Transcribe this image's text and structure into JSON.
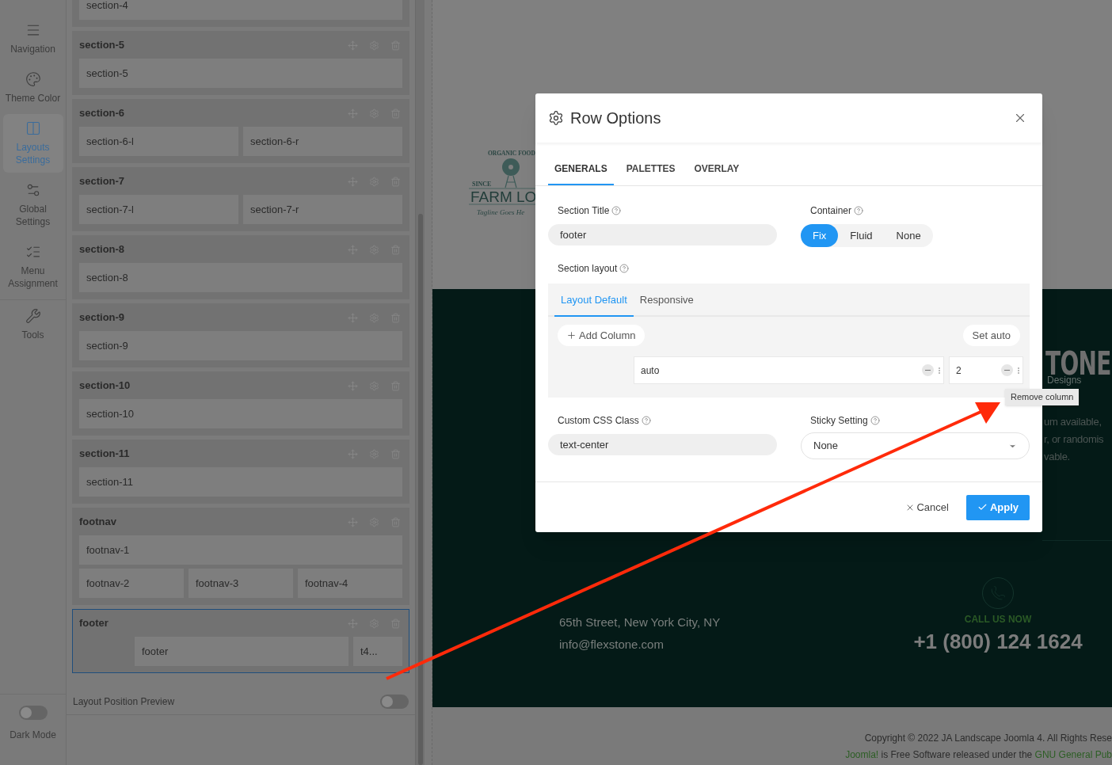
{
  "nav": {
    "items": [
      {
        "label": "Navigation",
        "selected": false
      },
      {
        "label": "Theme Color",
        "selected": false
      },
      {
        "label": "Layouts Settings",
        "selected": true
      },
      {
        "label": "Global Settings",
        "selected": false
      },
      {
        "label": "Menu Assignment",
        "selected": false
      },
      {
        "label": "Tools",
        "selected": false
      }
    ],
    "dark_mode": {
      "label": "Dark Mode",
      "on": false
    }
  },
  "layout": {
    "sections": [
      {
        "selected": false,
        "offset": false,
        "rows": [
          [
            "section-4"
          ]
        ]
      },
      {
        "title": "section-5",
        "selected": false,
        "offset": false,
        "rows": [
          [
            "section-5"
          ]
        ]
      },
      {
        "title": "section-6",
        "selected": false,
        "offset": false,
        "rows": [
          [
            "section-6-l",
            "section-6-r"
          ]
        ]
      },
      {
        "title": "section-7",
        "selected": false,
        "offset": false,
        "rows": [
          [
            "section-7-l",
            "section-7-r"
          ]
        ]
      },
      {
        "title": "section-8",
        "selected": false,
        "offset": false,
        "rows": [
          [
            "section-8"
          ]
        ]
      },
      {
        "title": "section-9",
        "selected": false,
        "offset": false,
        "rows": [
          [
            "section-9"
          ]
        ]
      },
      {
        "title": "section-10",
        "selected": false,
        "offset": false,
        "rows": [
          [
            "section-10"
          ]
        ]
      },
      {
        "title": "section-11",
        "selected": false,
        "offset": false,
        "rows": [
          [
            "section-11"
          ]
        ]
      },
      {
        "title": "footnav",
        "selected": false,
        "offset": false,
        "rows": [
          [
            "footnav-1"
          ],
          [
            "footnav-2",
            "footnav-3",
            "footnav-4"
          ]
        ]
      },
      {
        "title": "footer",
        "selected": true,
        "offset": true,
        "rows": [
          [
            "footer",
            "t4..."
          ]
        ]
      }
    ],
    "position_preview": {
      "label": "Layout Position Preview",
      "on": false
    }
  },
  "preview": {
    "logo": {
      "arc": "ORGANIC FOOD",
      "since": "SINCE",
      "name": "FARM LO",
      "tagline": "Tagline Goes He"
    },
    "brand": {
      "name": "TONE",
      "sub": "Designs"
    },
    "text_lines": [
      "um available,",
      "r, or randomis",
      "vable."
    ],
    "address": "65th Street, New York City, NY",
    "email": "info@flexstone.com",
    "call_label": "CALL US NOW",
    "phone": "+1 (800) 124 1624",
    "copyright": "Copyright © 2022 JA Landscape Joomla 4. All Rights Rese",
    "license": [
      {
        "text": "Joomla!",
        "kind": "link"
      },
      {
        "text": " is Free Software released under the ",
        "kind": "text"
      },
      {
        "text": "GNU General Pub",
        "kind": "link"
      }
    ]
  },
  "modal": {
    "title": "Row Options",
    "tabs": [
      {
        "label": "GENERALS",
        "selected": true
      },
      {
        "label": "PALETTES",
        "selected": false
      },
      {
        "label": "OVERLAY",
        "selected": false
      }
    ],
    "section_title": {
      "label": "Section Title",
      "value": "footer"
    },
    "container": {
      "label": "Container",
      "options": [
        {
          "label": "Fix",
          "selected": true
        },
        {
          "label": "Fluid",
          "selected": false
        },
        {
          "label": "None",
          "selected": false
        }
      ]
    },
    "section_layout": {
      "label": "Section layout",
      "tabs": [
        {
          "label": "Layout Default",
          "selected": true
        },
        {
          "label": "Responsive",
          "selected": false
        }
      ],
      "add_column": "Add Column",
      "set_auto": "Set auto",
      "columns": [
        {
          "value": "auto"
        },
        {
          "value": "2"
        }
      ]
    },
    "css_class": {
      "label": "Custom CSS Class",
      "value": "text-center"
    },
    "sticky": {
      "label": "Sticky Setting",
      "value": "None"
    },
    "tooltip": "Remove column",
    "cancel": "Cancel",
    "apply": "Apply"
  }
}
